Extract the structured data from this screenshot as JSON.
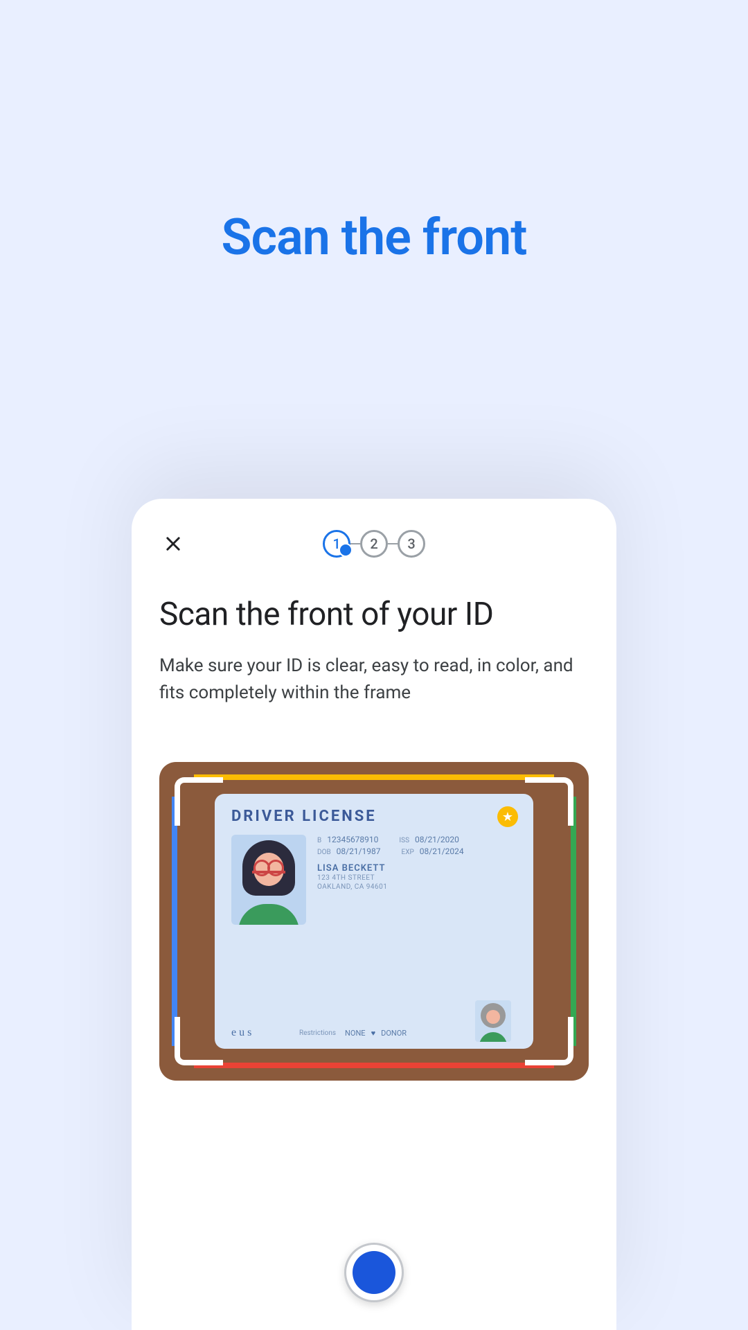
{
  "page": {
    "title": "Scan the front"
  },
  "stepper": {
    "steps": [
      "1",
      "2",
      "3"
    ],
    "activeIndex": 0
  },
  "screen": {
    "heading": "Scan the front of your ID",
    "subtext": "Make sure your ID is clear, easy to read, in color, and fits completely within the frame"
  },
  "idcard": {
    "title": "DRIVER LICENSE",
    "number_label": "B",
    "number": "12345678910",
    "dob_label": "DOB",
    "dob": "08/21/1987",
    "iss_label": "ISS",
    "iss": "08/21/2020",
    "exp_label": "EXP",
    "exp": "08/21/2024",
    "name": "LISA BECKETT",
    "addr1": "123 4TH STREET",
    "addr2": "OAKLAND, CA 94601",
    "signature": "e u s",
    "restrictions_label": "Restrictions",
    "restrictions_value": "NONE",
    "donor_label": "DONOR"
  }
}
